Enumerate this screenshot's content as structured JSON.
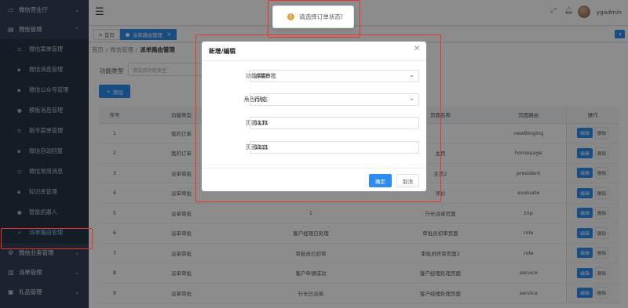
{
  "sidebar": {
    "group_wechat_hall": "微信营业厅",
    "group_wechat_mgmt": "微信管理",
    "items": [
      {
        "label": "微信菜单管理",
        "icon": "menu-lines-icon"
      },
      {
        "label": "微信消息管理",
        "icon": "message-icon"
      },
      {
        "label": "微信公众号管理",
        "icon": "chat-icon"
      },
      {
        "label": "模板消息管理",
        "icon": "chat-icon"
      },
      {
        "label": "指令菜单管理",
        "icon": "menu-lines-icon"
      },
      {
        "label": "微信自动回复",
        "icon": "reply-icon"
      },
      {
        "label": "微信常用消息",
        "icon": "clock-icon"
      },
      {
        "label": "知识库管理",
        "icon": "book-icon"
      },
      {
        "label": "智能机器人",
        "icon": "robot-icon"
      },
      {
        "label": "派单路由管理",
        "icon": "lightbulb-icon"
      }
    ],
    "group_business": "微信业务管理",
    "group_dispatch": "派单管理",
    "group_gift": "礼品管理"
  },
  "header": {
    "username": "ygadmin"
  },
  "toast": {
    "text": "请选择订单状态!"
  },
  "tabs": {
    "home": "首页",
    "active": "派单路由管理"
  },
  "breadcrumb": {
    "home": "首页",
    "parent": "微信管理",
    "current": "派单路由管理"
  },
  "filter": {
    "label": "功能类型",
    "placeholder": "请选择功能类型"
  },
  "add_button": "添加",
  "table": {
    "headers": {
      "no": "序号",
      "type": "功能类型",
      "role": "角色/状态",
      "name": "页面名称",
      "route": "页面路由",
      "op": "操作"
    },
    "edit_label": "编辑",
    "delete_label": "删除",
    "rows": [
      {
        "no": "1",
        "type": "我的订单",
        "role": "",
        "name": "",
        "route": "newBinging"
      },
      {
        "no": "2",
        "type": "我的订单",
        "role": "",
        "name": "主页",
        "route": "homepage"
      },
      {
        "no": "3",
        "type": "派单审批",
        "role": "",
        "name": "主页2",
        "route": "president"
      },
      {
        "no": "4",
        "type": "派单审批",
        "role": "",
        "name": "评价",
        "route": "evaluate"
      },
      {
        "no": "5",
        "type": "派单审批",
        "role": "1",
        "name": "行长派单页面",
        "route": "trip"
      },
      {
        "no": "6",
        "type": "派单审批",
        "role": "客户经理已处理",
        "name": "审批员初审页面",
        "route": "role"
      },
      {
        "no": "7",
        "type": "派单审批",
        "role": "审批员已初审",
        "name": "审批员终审页面2",
        "route": "role"
      },
      {
        "no": "8",
        "type": "派单审批",
        "role": "客户申请成功",
        "name": "客户经理处理页面",
        "route": "service"
      },
      {
        "no": "9",
        "type": "派单审批",
        "role": "行长已派单",
        "name": "客户经理处理页面",
        "route": "service"
      }
    ]
  },
  "modal": {
    "title": "新增/编辑",
    "type_label": "功能类型",
    "type_value": "派单审批",
    "role_label": "角色/状态",
    "role_value": "行长",
    "name_label": "页面名称",
    "name_value": "1111",
    "route_label": "页面路由",
    "route_value": "1111",
    "ok_label": "确定",
    "cancel_label": "取消"
  },
  "colors": {
    "primary": "#2d8cf0",
    "sidebar": "#304156",
    "highlight": "#e8342b",
    "warning": "#e6a23c"
  }
}
